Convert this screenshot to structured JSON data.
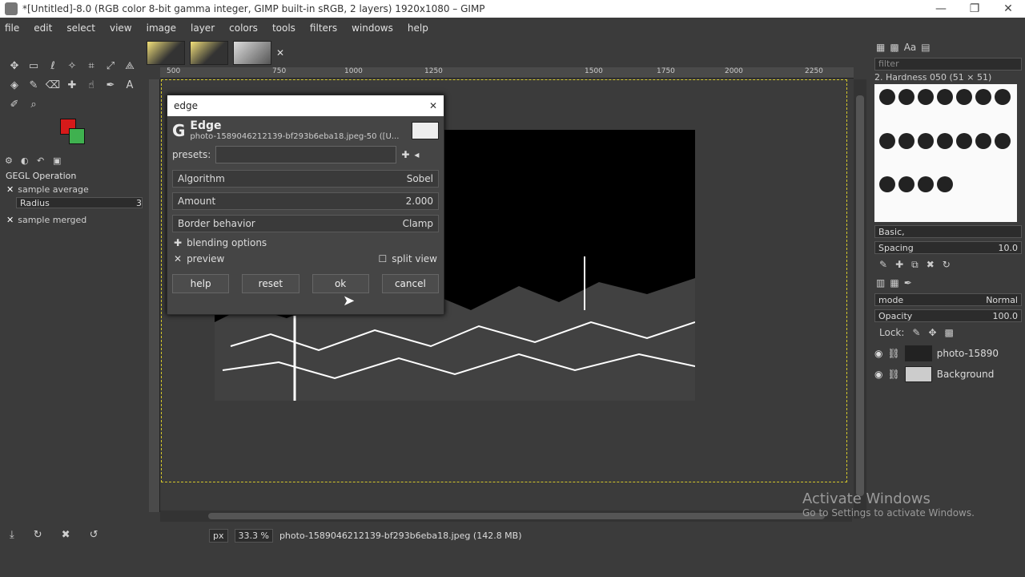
{
  "window": {
    "title": "*[Untitled]-8.0 (RGB color 8-bit gamma integer, GIMP built-in sRGB, 2 layers) 1920x1080 – GIMP",
    "controls": [
      "—",
      "❐",
      "✕"
    ]
  },
  "menubar": [
    "file",
    "edit",
    "select",
    "view",
    "image",
    "layer",
    "colors",
    "tools",
    "filters",
    "windows",
    "help"
  ],
  "toolbox": {
    "colors": {
      "fg": "#d61a1a",
      "bg": "#3fb14f"
    },
    "options_title": "GEGL Operation",
    "sample_average": "sample average",
    "radius_label": "Radius",
    "radius_value": "3",
    "sample_merged": "sample merged"
  },
  "ruler": {
    "marks": [
      "500",
      "750",
      "1000",
      "1250",
      "1500",
      "1750",
      "2000",
      "2250"
    ]
  },
  "dialog": {
    "window_title": "edge",
    "filter_name": "Edge",
    "filter_source": "photo-1589046212139-bf293b6eba18.jpeg-50 ([U...",
    "presets_label": "presets:",
    "algorithm_label": "Algorithm",
    "algorithm_value": "Sobel",
    "amount_label": "Amount",
    "amount_value": "2.000",
    "border_label": "Border behavior",
    "border_value": "Clamp",
    "blending_label": "blending options",
    "preview_label": "preview",
    "split_label": "split view",
    "buttons": {
      "help": "help",
      "reset": "reset",
      "ok": "ok",
      "cancel": "cancel"
    }
  },
  "statusbar": {
    "unit": "px",
    "zoom": "33.3 %",
    "file_info": "photo-1589046212139-bf293b6eba18.jpeg (142.8 MB)"
  },
  "brushes": {
    "filter_placeholder": "filter",
    "current": "2. Hardness 050 (51 × 51)",
    "tag_value": "Basic,",
    "spacing_label": "Spacing",
    "spacing_value": "10.0"
  },
  "layers": {
    "mode_label": "mode",
    "mode_value": "Normal",
    "opacity_label": "Opacity",
    "opacity_value": "100.0",
    "lock_label": "Lock:",
    "items": [
      "photo-15890",
      "Background"
    ]
  },
  "watermark": {
    "line1": "Activate Windows",
    "line2": "Go to Settings to activate Windows."
  }
}
